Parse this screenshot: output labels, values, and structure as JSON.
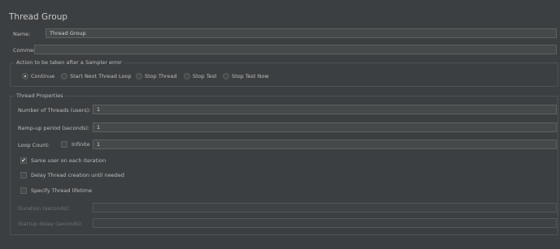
{
  "panel": {
    "title": "Thread Group"
  },
  "name": {
    "label": "Name:",
    "value": "Thread Group"
  },
  "comments": {
    "label": "Comments:",
    "value": ""
  },
  "sampler_error": {
    "title": "Action to be taken after a Sampler error",
    "options": [
      {
        "label": "Continue",
        "selected": true
      },
      {
        "label": "Start Next Thread Loop",
        "selected": false
      },
      {
        "label": "Stop Thread",
        "selected": false
      },
      {
        "label": "Stop Test",
        "selected": false
      },
      {
        "label": "Stop Test Now",
        "selected": false
      }
    ]
  },
  "thread_props": {
    "title": "Thread Properties",
    "threads": {
      "label": "Number of Threads (users):",
      "value": "1"
    },
    "rampup": {
      "label": "Ramp-up period (seconds):",
      "value": "1"
    },
    "loop": {
      "label": "Loop Count:",
      "infinite_label": "Infinite",
      "infinite_checked": false,
      "value": "1"
    },
    "same_user": {
      "label": "Same user on each iteration",
      "checked": true
    },
    "delay_creation": {
      "label": "Delay Thread creation until needed",
      "checked": false
    },
    "lifetime": {
      "label": "Specify Thread lifetime",
      "checked": false
    },
    "duration": {
      "label": "Duration (seconds):",
      "value": ""
    },
    "startup_delay": {
      "label": "Startup delay (seconds):",
      "value": ""
    }
  },
  "icons": {
    "check": "✔"
  }
}
